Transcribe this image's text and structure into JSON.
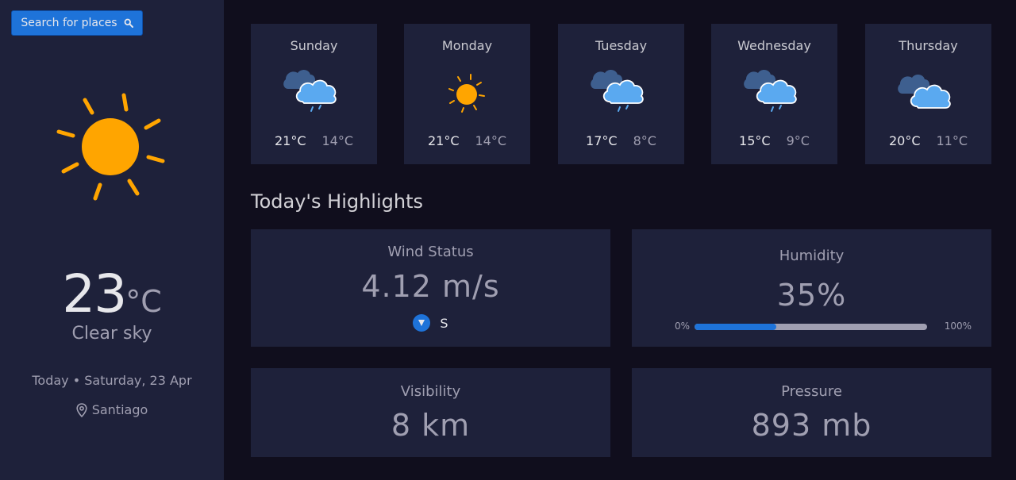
{
  "search": {
    "label": "Search for places",
    "icon": "search-icon"
  },
  "current": {
    "icon": "sun-icon",
    "temp": "23",
    "unit": "°C",
    "condition": "Clear sky",
    "date": "Today • Saturday, 23 Apr",
    "location": "Santiago",
    "location_icon": "location-pin-icon"
  },
  "forecast": [
    {
      "day": "Sunday",
      "icon": "rain-cloud-icon",
      "max": "21°C",
      "min": "14°C"
    },
    {
      "day": "Monday",
      "icon": "sun-icon",
      "max": "21°C",
      "min": "14°C"
    },
    {
      "day": "Tuesday",
      "icon": "rain-cloud-icon",
      "max": "17°C",
      "min": "8°C"
    },
    {
      "day": "Wednesday",
      "icon": "rain-cloud-icon",
      "max": "15°C",
      "min": "9°C"
    },
    {
      "day": "Thursday",
      "icon": "cloud-icon",
      "max": "20°C",
      "min": "11°C"
    }
  ],
  "highlights": {
    "title": "Today's Highlights",
    "wind": {
      "label": "Wind Status",
      "value": "4.12 m/s",
      "direction": "S",
      "icon": "wind-direction-arrow-icon"
    },
    "humidity": {
      "label": "Humidity",
      "value": "35%",
      "percent": 35,
      "min_label": "0%",
      "max_label": "100%"
    },
    "visibility": {
      "label": "Visibility",
      "value": "8 km"
    },
    "pressure": {
      "label": "Pressure",
      "value": "893 mb"
    }
  },
  "colors": {
    "accent": "#1e73d9",
    "sun": "#ffa500",
    "cloud": "#5aa9f0",
    "cloud_back": "#3e5f8f",
    "card": "#1e213a",
    "background": "#100e1d"
  }
}
